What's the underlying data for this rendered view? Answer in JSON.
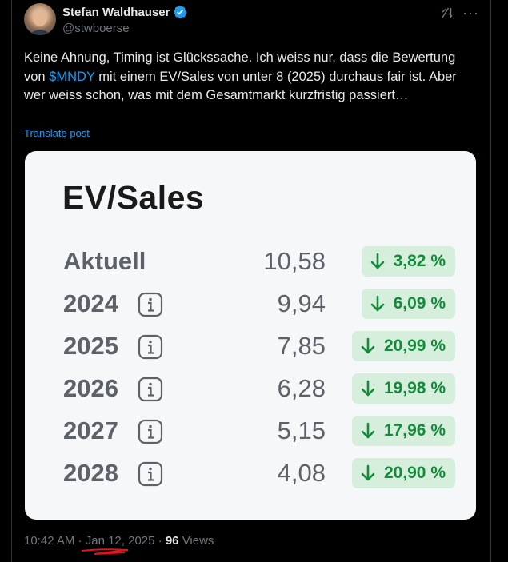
{
  "author": {
    "name": "Stefan Waldhauser",
    "handle": "@stwboerse"
  },
  "tweet": {
    "text_before": "Keine Ahnung, Timing ist Glückssache. Ich weiss nur, dass die Bewertung von ",
    "cashtag": "$MNDY",
    "text_after": " mit einem EV/Sales von unter 8 (2025) durchaus fair ist. Aber wer weiss schon, was mit dem Gesamtmarkt kurzfristig passiert…",
    "translate_label": "Translate post"
  },
  "card": {
    "title": "EV/Sales",
    "rows": [
      {
        "label": "Aktuell",
        "value": "10,58",
        "change": "3,82 %",
        "info": false
      },
      {
        "label": "2024",
        "value": "9,94",
        "change": "6,09 %",
        "info": true
      },
      {
        "label": "2025",
        "value": "7,85",
        "change": "20,99 %",
        "info": true
      },
      {
        "label": "2026",
        "value": "6,28",
        "change": "19,98 %",
        "info": true
      },
      {
        "label": "2027",
        "value": "5,15",
        "change": "17,96 %",
        "info": true
      },
      {
        "label": "2028",
        "value": "4,08",
        "change": "20,90 %",
        "info": true
      }
    ]
  },
  "meta": {
    "time": "10:42 AM",
    "separator": "·",
    "date": "Jan 12, 2025",
    "views_count": "96",
    "views_label": "Views"
  },
  "icons": {
    "verified": "verified-badge-icon",
    "grok": "grok-icon",
    "more": "more-icon",
    "info": "info-icon",
    "arrow_down": "arrow-down-icon"
  },
  "colors": {
    "background": "#000000",
    "link": "#1d9bf0",
    "card_bg": "#f6f7f9",
    "badge_bg": "#d5efdc",
    "badge_text": "#148a3a"
  }
}
